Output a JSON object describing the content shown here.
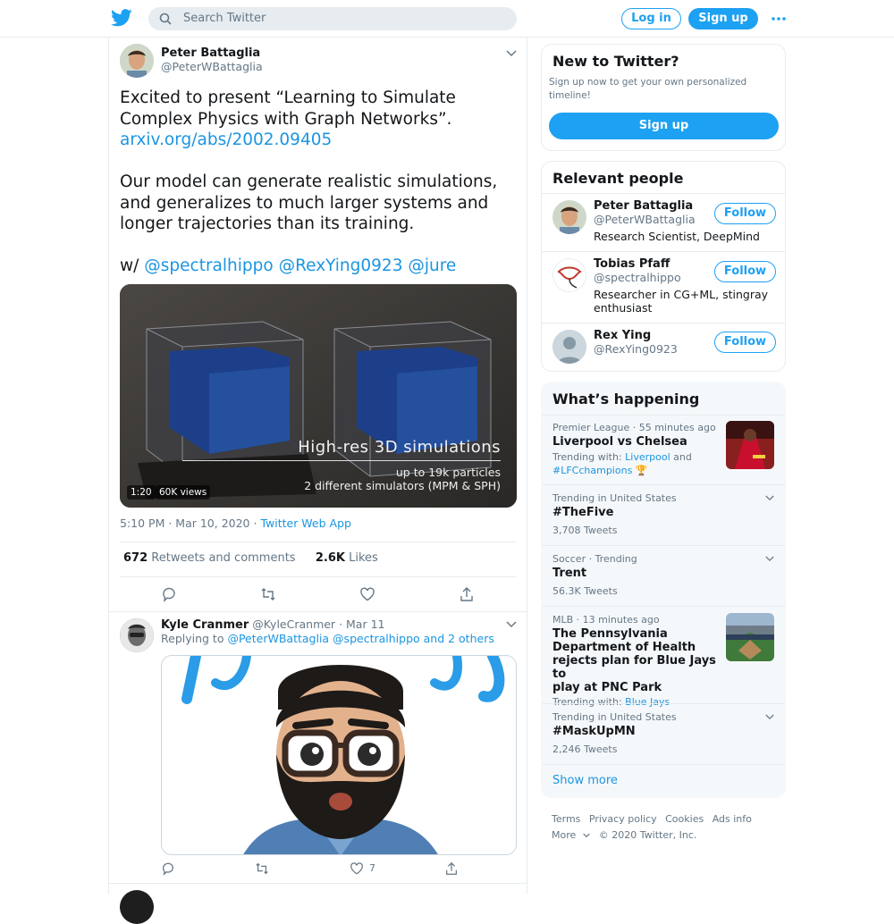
{
  "header": {
    "search_placeholder": "Search Twitter",
    "login_label": "Log in",
    "signup_label": "Sign up"
  },
  "tweet": {
    "author_name": "Peter Battaglia",
    "author_handle": "@PeterWBattaglia",
    "text_line1": "Excited to present “Learning to Simulate",
    "text_line2": "Complex Physics with Graph Networks”.",
    "link": "arxiv.org/abs/2002.09405",
    "text_para2_l1": "Our model can generate realistic simulations,",
    "text_para2_l2": "and generalizes to much larger systems and",
    "text_para2_l3": "longer trajectories than its training.",
    "with_prefix": "w/",
    "mentions": [
      "@spectralhippo",
      "@RexYing0923",
      "@jure"
    ],
    "media": {
      "title": "High-res 3D simulations",
      "line1": "up to 19k particles",
      "line2": "2 different simulators (MPM & SPH)",
      "duration": "1:20",
      "views": "60K views"
    },
    "timestamp": "5:10 PM · Mar 10, 2020",
    "source_sep": " · ",
    "source": "Twitter Web App",
    "retweets_count": "672",
    "retweets_label": "Retweets and comments",
    "likes_count": "2.6K",
    "likes_label": "Likes"
  },
  "reply": {
    "author_name": "Kyle Cranmer",
    "author_handle": "@KyleCranmer",
    "date": "· Mar 11",
    "replying_prefix": "Replying to",
    "replying_to": "@PeterWBattaglia @spectralhippo and 2 others",
    "like_count": "7"
  },
  "sidebar": {
    "new_title": "New to Twitter?",
    "new_sub_l1": "Sign up now to get your own personalized",
    "new_sub_l2": "timeline!",
    "new_signup": "Sign up",
    "people_title": "Relevant people",
    "people": [
      {
        "name": "Peter Battaglia",
        "handle": "@PeterWBattaglia",
        "bio": "Research Scientist, DeepMind",
        "follow": "Follow"
      },
      {
        "name": "Tobias Pfaff",
        "handle": "@spectralhippo",
        "bio_l1": "Researcher in CG+ML, stingray",
        "bio_l2": "enthusiast",
        "follow": "Follow"
      },
      {
        "name": "Rex Ying",
        "handle": "@RexYing0923",
        "follow": "Follow"
      }
    ],
    "happening_title": "What’s happening",
    "trends": [
      {
        "context": "Premier League · 55 minutes ago",
        "title": "Liverpool vs Chelsea",
        "with_prefix": "Trending with:",
        "with_link1": "Liverpool",
        "with_and": "and",
        "with_link2": "#LFCchampions 🏆"
      },
      {
        "context": "Trending in United States",
        "title": "#TheFive",
        "count": "3,708 Tweets"
      },
      {
        "context": "Soccer · Trending",
        "title": "Trent",
        "count": "56.3K Tweets"
      },
      {
        "context": "MLB · 13 minutes ago",
        "title_l1": "The Pennsylvania",
        "title_l2": "Department of Health",
        "title_l3": "rejects plan for Blue Jays to",
        "title_l4": "play at PNC Park",
        "with_prefix": "Trending with:",
        "with_link1": "Blue Jays"
      },
      {
        "context": "Trending in United States",
        "title": "#MaskUpMN",
        "count": "2,246 Tweets"
      }
    ],
    "show_more": "Show more"
  },
  "footer": {
    "links": [
      "Terms",
      "Privacy policy",
      "Cookies",
      "Ads info"
    ],
    "more": "More",
    "copyright": "© 2020 Twitter, Inc."
  },
  "colors": {
    "accent": "#1da1f2",
    "link": "#1b95e0",
    "muted": "#657786",
    "border": "#e6ecf0",
    "panel": "#f5f8fa"
  }
}
